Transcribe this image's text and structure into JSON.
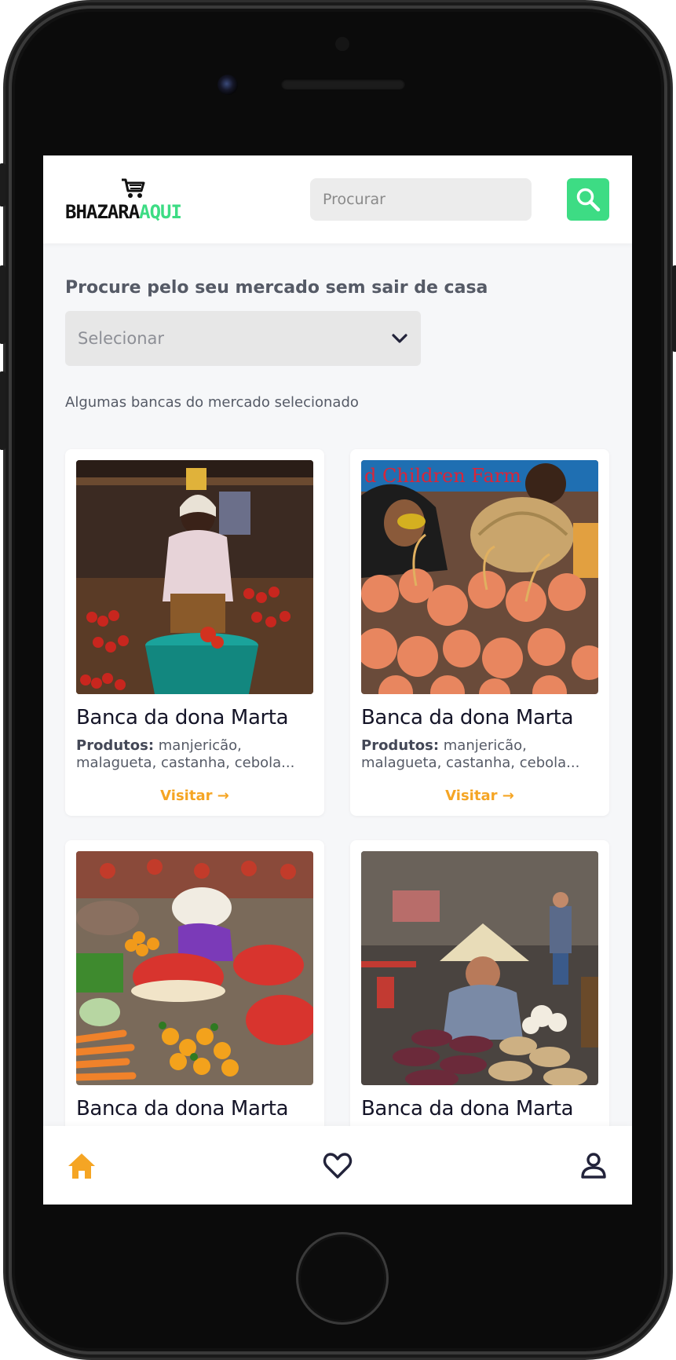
{
  "header": {
    "logo_part1": "BHAZARA",
    "logo_part2": "AQUI",
    "search_placeholder": "Procurar",
    "search_value": ""
  },
  "main": {
    "heading": "Procure pelo seu mercado sem sair de casa",
    "select_value": "Selecionar",
    "subtext": "Algumas bancas do mercado selecionado"
  },
  "stalls": [
    {
      "title": "Banca da dona Marta",
      "products_label": "Produtos:",
      "products_line1": "manjericão,",
      "products_line2": "malagueta, castanha, cebola...",
      "visit_label": "Visitar →"
    },
    {
      "title": "Banca da dona Marta",
      "products_label": "Produtos:",
      "products_line1": "manjericão,",
      "products_line2": "malagueta, castanha, cebola...",
      "visit_label": "Visitar →"
    },
    {
      "title": "Banca da dona Marta"
    },
    {
      "title": "Banca da dona Marta"
    }
  ],
  "image_text": {
    "banner": "d Children Farm"
  },
  "bottom_nav": {
    "home_icon": "home-icon",
    "favorites_icon": "heart-icon",
    "profile_icon": "user-icon"
  },
  "colors": {
    "accent_green": "#3ddc84",
    "accent_orange": "#f5a524",
    "text_dark": "#151528",
    "text_muted": "#555a66",
    "screen_bg": "#f6f7f9"
  }
}
